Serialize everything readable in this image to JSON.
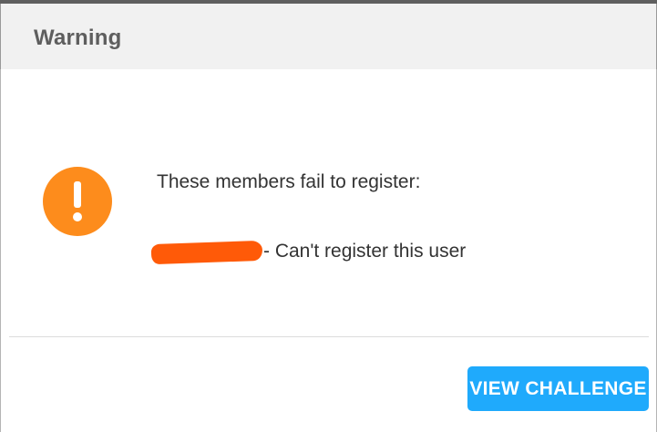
{
  "dialog": {
    "title": "Warning",
    "message": "These members fail to register:",
    "members": [
      {
        "error": "- Can't register this user"
      }
    ],
    "button_label": "VIEW CHALLENGE"
  },
  "colors": {
    "header_bg": "#f1f1f1",
    "warning_icon": "#fd8c1c",
    "redaction": "#ff5a08",
    "button_bg": "#1faafc"
  },
  "icons": {
    "warning": "exclamation-circle-icon"
  }
}
